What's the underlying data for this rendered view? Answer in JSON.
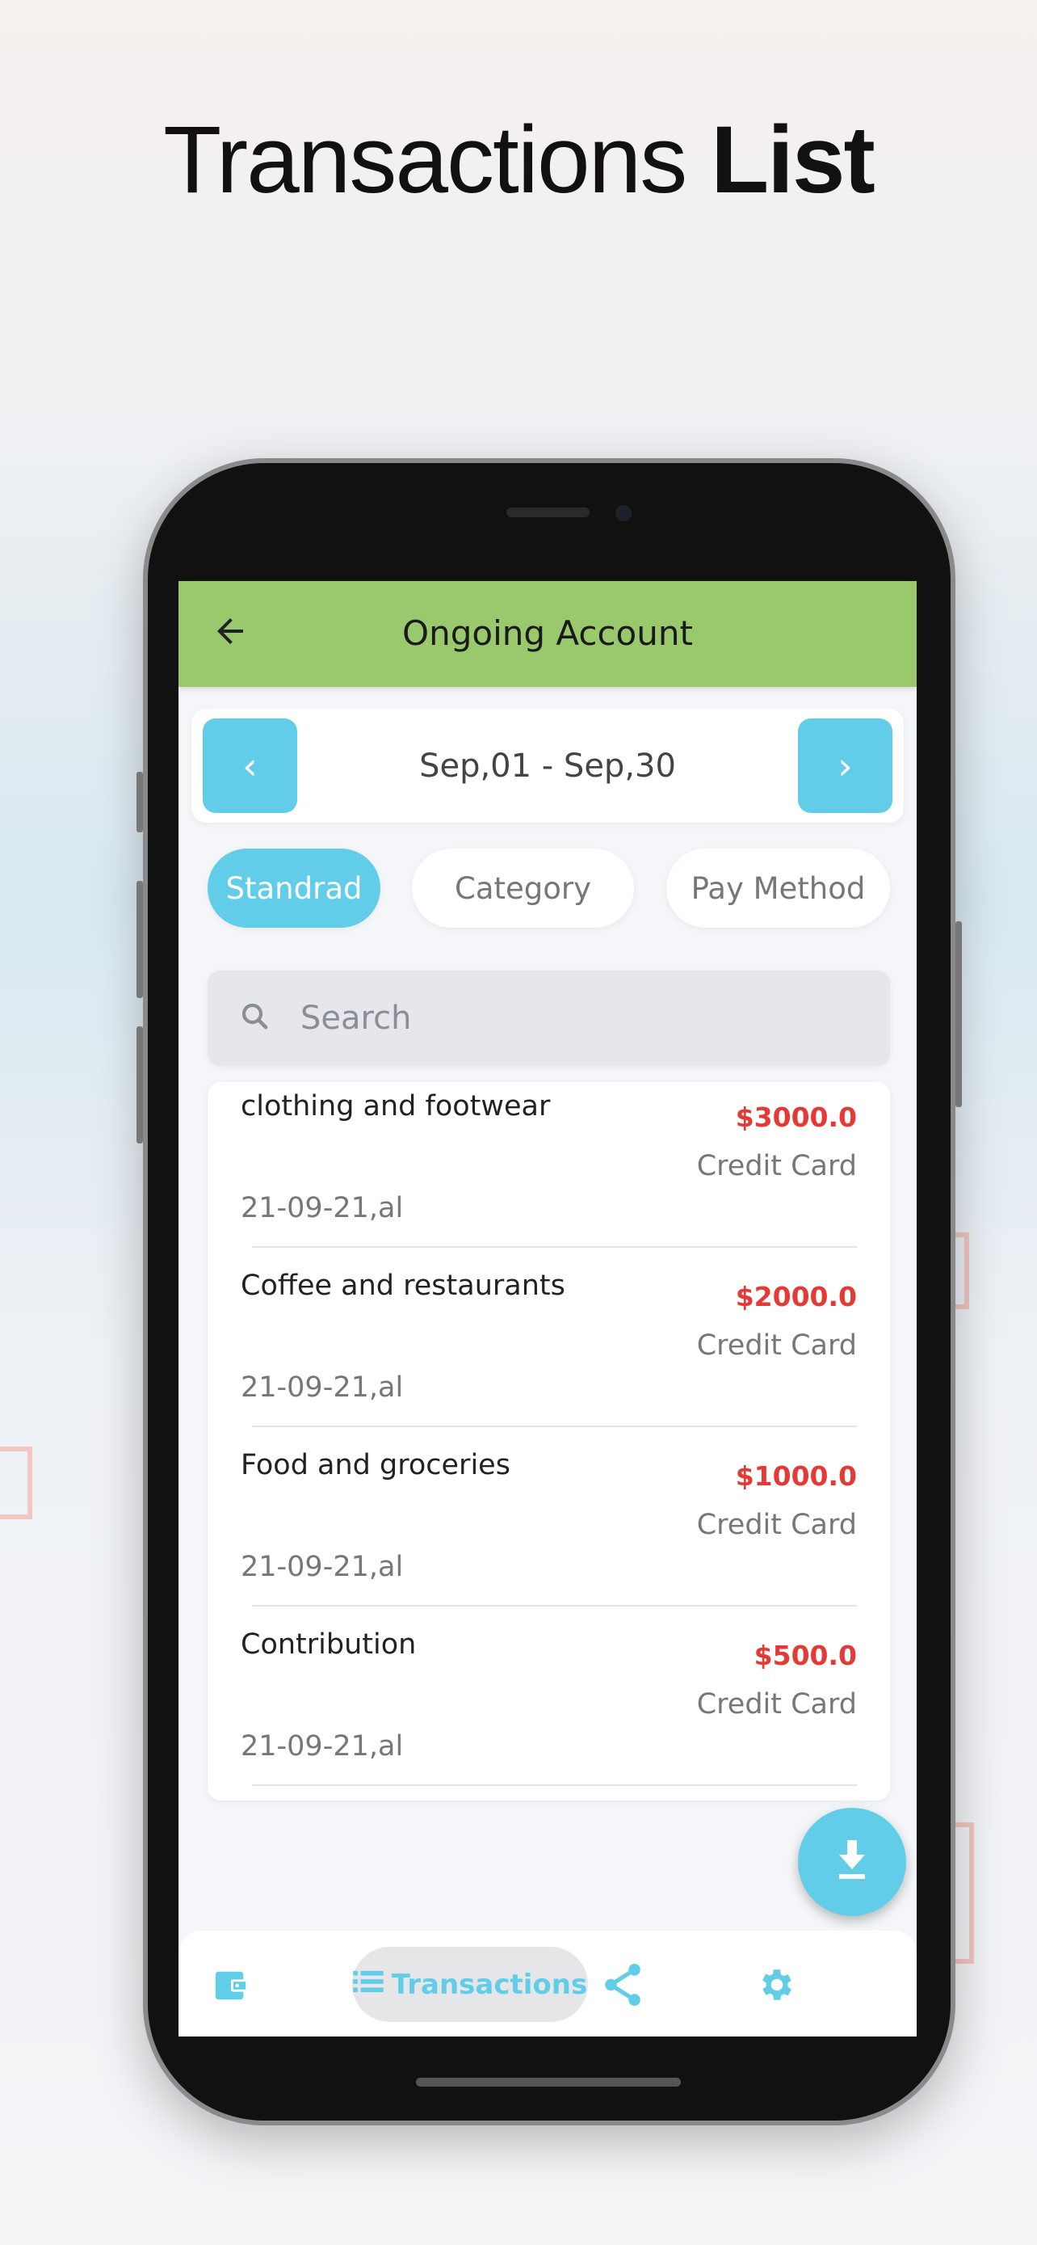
{
  "hero": {
    "title_regular": "Transactions",
    "title_bold": "List"
  },
  "header": {
    "title": "Ongoing Account",
    "back_icon": "arrow-left-icon"
  },
  "date_nav": {
    "range": "Sep,01 - Sep,30",
    "prev": "‹",
    "next": "›"
  },
  "filters": [
    {
      "label": "Standrad",
      "active": true
    },
    {
      "label": "Category",
      "active": false
    },
    {
      "label": "Pay Method",
      "active": false
    }
  ],
  "search": {
    "placeholder": "Search"
  },
  "transactions": [
    {
      "name": "clothing and footwear",
      "amount": "$3000.0",
      "method": "Credit Card",
      "date": "21-09-21,al"
    },
    {
      "name": "Coffee and restaurants",
      "amount": "$2000.0",
      "method": "Credit Card",
      "date": "21-09-21,al"
    },
    {
      "name": "Food and groceries",
      "amount": "$1000.0",
      "method": "Credit Card",
      "date": "21-09-21,al"
    },
    {
      "name": "Contribution",
      "amount": "$500.0",
      "method": "Credit Card",
      "date": "21-09-21,al"
    }
  ],
  "bottom_nav": {
    "active_label": "Transactions",
    "items": [
      "wallet-icon",
      "list-icon",
      "share-icon",
      "gear-icon"
    ]
  },
  "colors": {
    "header": "#9ac86c",
    "accent": "#62cde8",
    "amount": "#e53935"
  }
}
